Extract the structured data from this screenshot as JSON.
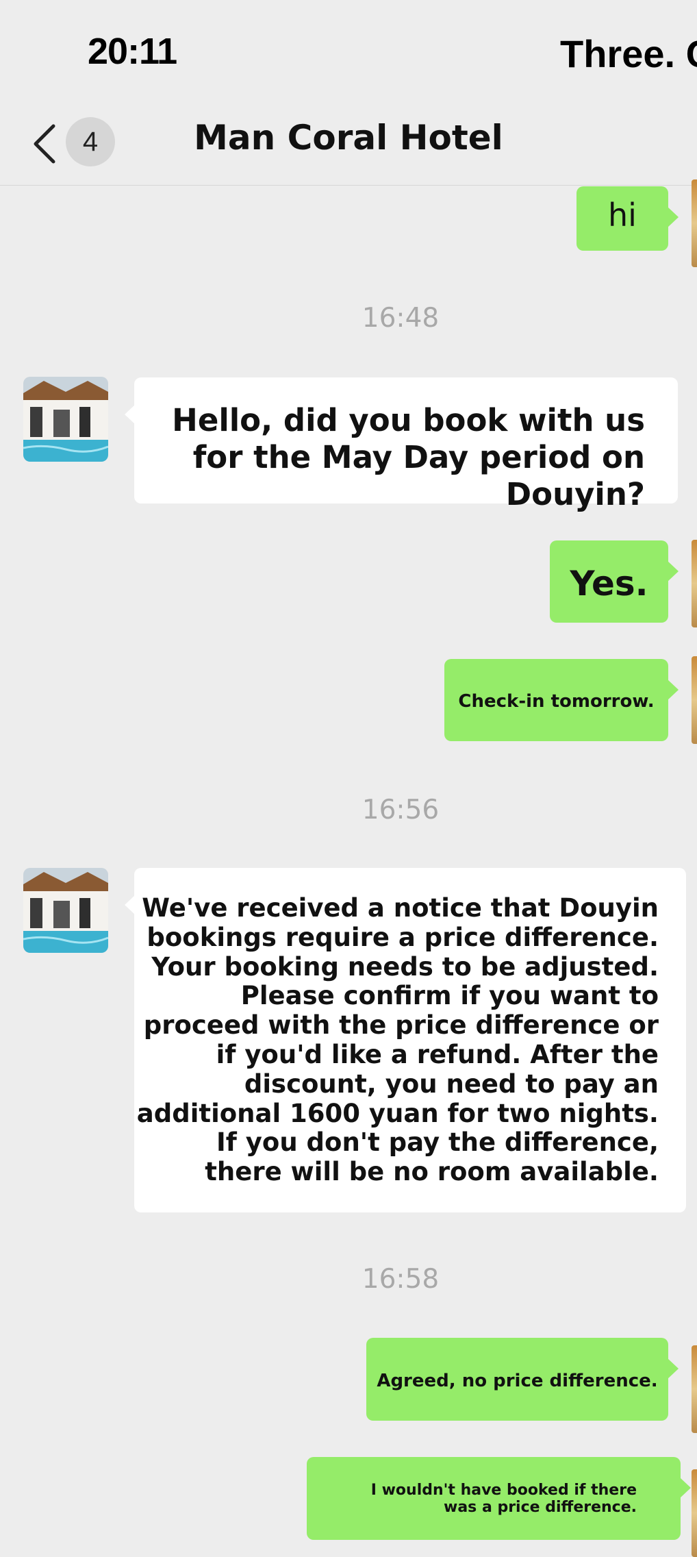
{
  "status_bar": {
    "time": "20:11",
    "carrier": "Three. C"
  },
  "nav": {
    "badge_count": "4",
    "title": "Man Coral Hotel"
  },
  "timestamps": [
    "16:48",
    "16:56",
    "16:58"
  ],
  "messages": [
    {
      "sender": "me",
      "text": "hi"
    },
    {
      "sender": "hotel",
      "text": "Hello, did you book with us for the May Day period on Douyin?"
    },
    {
      "sender": "me",
      "text": "Yes."
    },
    {
      "sender": "me",
      "text": "Check-in tomorrow."
    },
    {
      "sender": "hotel",
      "text": "We've received a notice that Douyin bookings require a price difference. Your booking needs to be adjusted. Please confirm if you want to proceed with the price difference or if you'd like a refund. After the discount, you need to pay an additional 1600 yuan for two nights. If you don't pay the difference, there will be no room available."
    },
    {
      "sender": "me",
      "text": "Agreed, no price difference."
    },
    {
      "sender": "me",
      "text": "I wouldn't have booked if there was a price difference."
    }
  ],
  "colors": {
    "background": "#ededed",
    "outgoing_bubble": "#95ec69",
    "incoming_bubble": "#ffffff",
    "timestamp": "#a8a8a8",
    "badge": "#d6d6d6"
  },
  "icons": {
    "back": "chevron-left-icon",
    "hotel_avatar": "hotel-pool-avatar",
    "self_avatar": "user-avatar"
  }
}
